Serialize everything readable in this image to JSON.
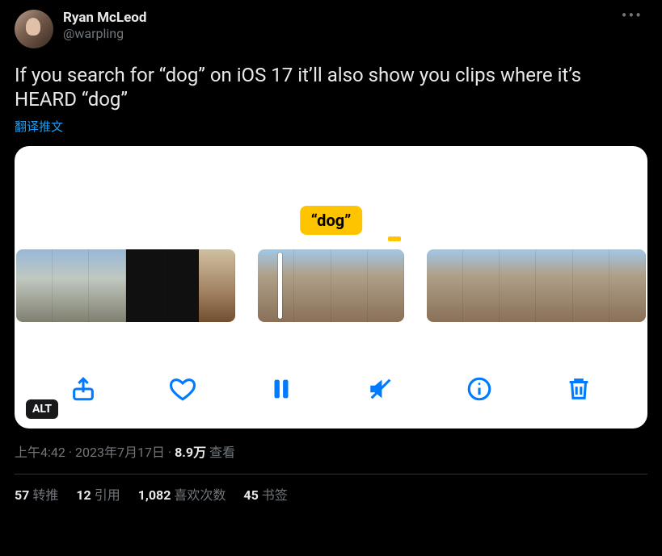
{
  "author": {
    "display_name": "Ryan McLeod",
    "handle": "@warpling"
  },
  "tweet_text": "If you search for “dog” on iOS 17 it’ll also show you clips where it’s HEARD “dog”",
  "translate_label": "翻译推文",
  "media": {
    "search_term_display": "“dog”",
    "alt_badge": "ALT",
    "toolbar_icons": {
      "share": "share-icon",
      "like": "heart-icon",
      "pause": "pause-icon",
      "mute": "mute-icon",
      "info": "info-icon",
      "trash": "trash-icon"
    }
  },
  "meta": {
    "time": "上午4:42",
    "date": "2023年7月17日",
    "separator": " · ",
    "views_count": "8.9万",
    "views_label": " 查看"
  },
  "stats": {
    "retweets": {
      "count": "57",
      "label": "转推"
    },
    "quotes": {
      "count": "12",
      "label": "引用"
    },
    "likes": {
      "count": "1,082",
      "label": "喜欢次数"
    },
    "bookmarks": {
      "count": "45",
      "label": "书签"
    }
  },
  "more_button": "•••"
}
